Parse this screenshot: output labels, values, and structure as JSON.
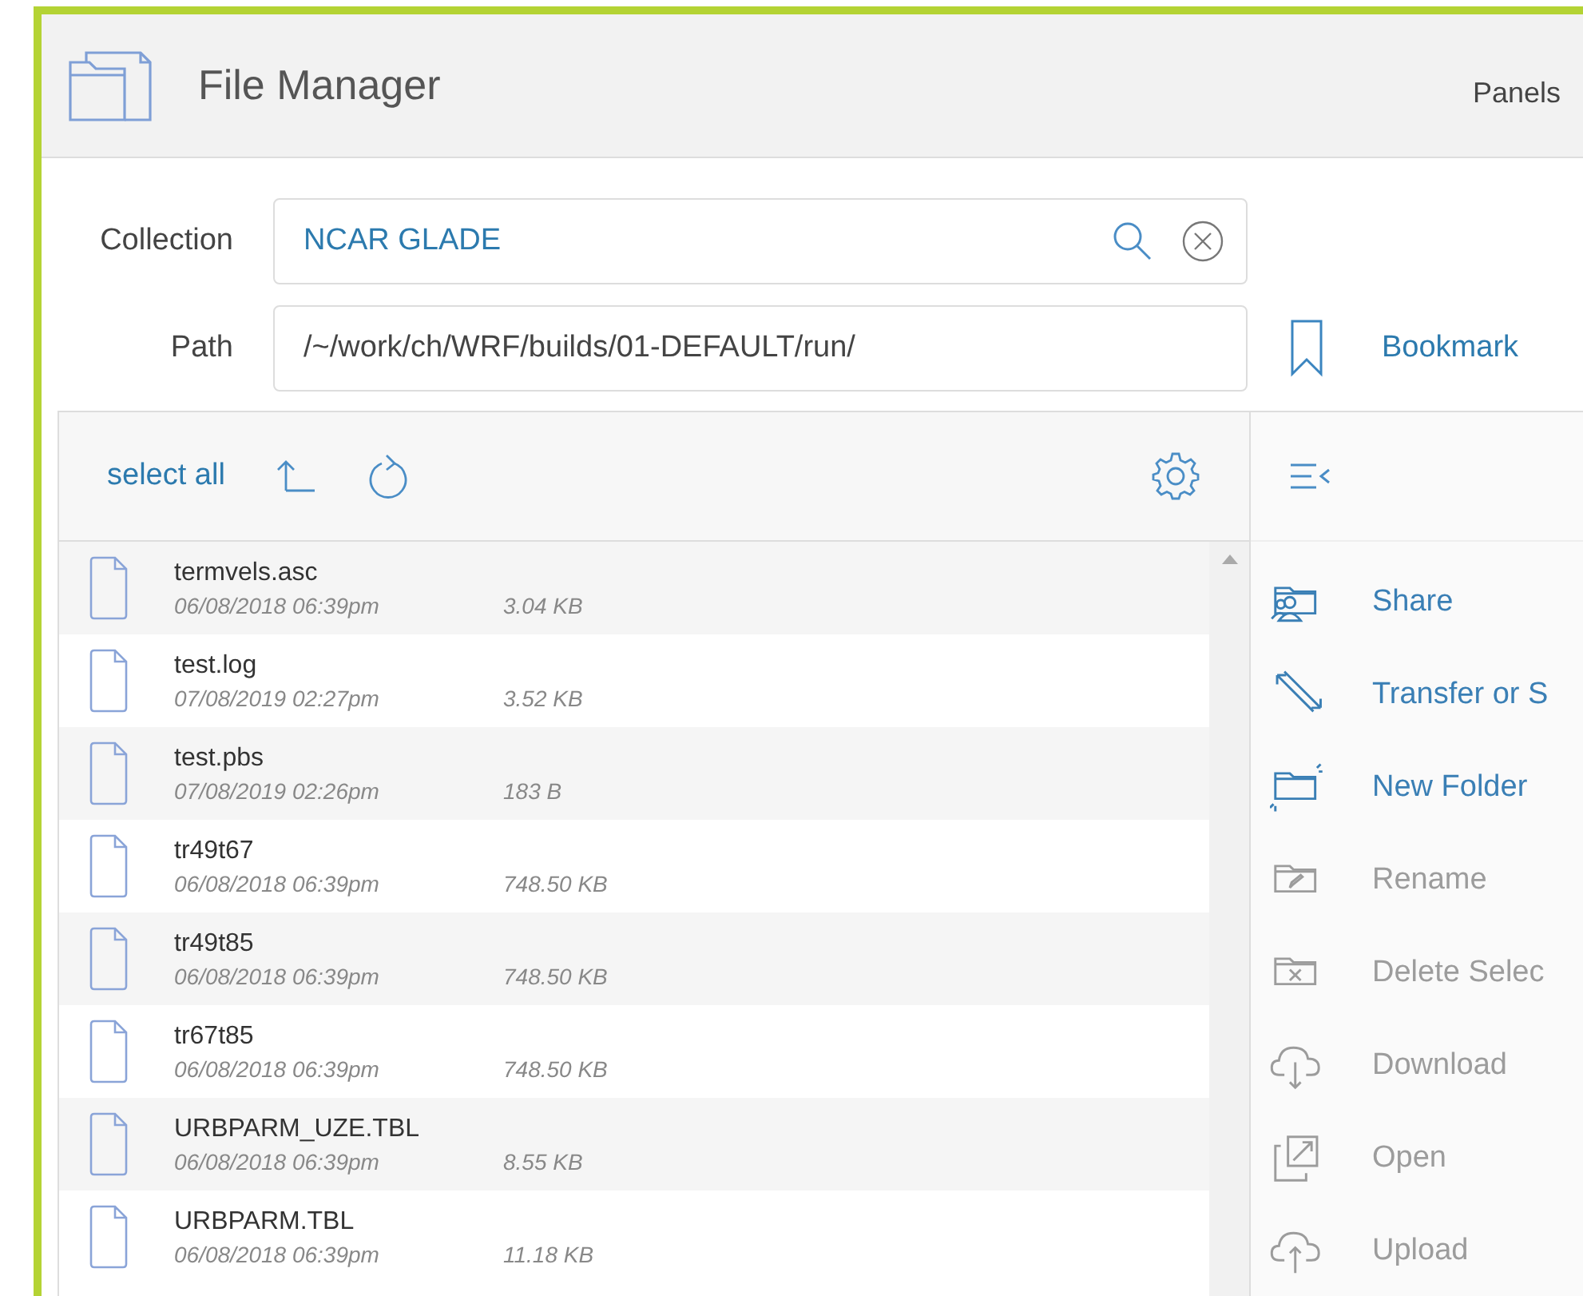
{
  "header": {
    "title": "File Manager",
    "panels_label": "Panels"
  },
  "collection": {
    "label": "Collection",
    "value": "NCAR GLADE"
  },
  "path": {
    "label": "Path",
    "value": "/~/work/ch/WRF/builds/01-DEFAULT/run/",
    "bookmark_label": "Bookmark"
  },
  "toolbar": {
    "select_all": "select all"
  },
  "files": [
    {
      "name": "termvels.asc",
      "modified": "06/08/2018 06:39pm",
      "size": "3.04 KB"
    },
    {
      "name": "test.log",
      "modified": "07/08/2019 02:27pm",
      "size": "3.52 KB"
    },
    {
      "name": "test.pbs",
      "modified": "07/08/2019 02:26pm",
      "size": "183 B"
    },
    {
      "name": "tr49t67",
      "modified": "06/08/2018 06:39pm",
      "size": "748.50 KB"
    },
    {
      "name": "tr49t85",
      "modified": "06/08/2018 06:39pm",
      "size": "748.50 KB"
    },
    {
      "name": "tr67t85",
      "modified": "06/08/2018 06:39pm",
      "size": "748.50 KB"
    },
    {
      "name": "URBPARM_UZE.TBL",
      "modified": "06/08/2018 06:39pm",
      "size": "8.55 KB"
    },
    {
      "name": "URBPARM.TBL",
      "modified": "06/08/2018 06:39pm",
      "size": "11.18 KB"
    }
  ],
  "actions": [
    {
      "kind": "share",
      "label": "Share",
      "disabled": false
    },
    {
      "kind": "transfer",
      "label": "Transfer or S",
      "disabled": false
    },
    {
      "kind": "new-folder",
      "label": "New Folder",
      "disabled": false
    },
    {
      "kind": "rename",
      "label": "Rename",
      "disabled": true
    },
    {
      "kind": "delete",
      "label": "Delete Selec",
      "disabled": true
    },
    {
      "kind": "download",
      "label": "Download",
      "disabled": true
    },
    {
      "kind": "open",
      "label": "Open",
      "disabled": true
    },
    {
      "kind": "upload",
      "label": "Upload",
      "disabled": true
    }
  ]
}
